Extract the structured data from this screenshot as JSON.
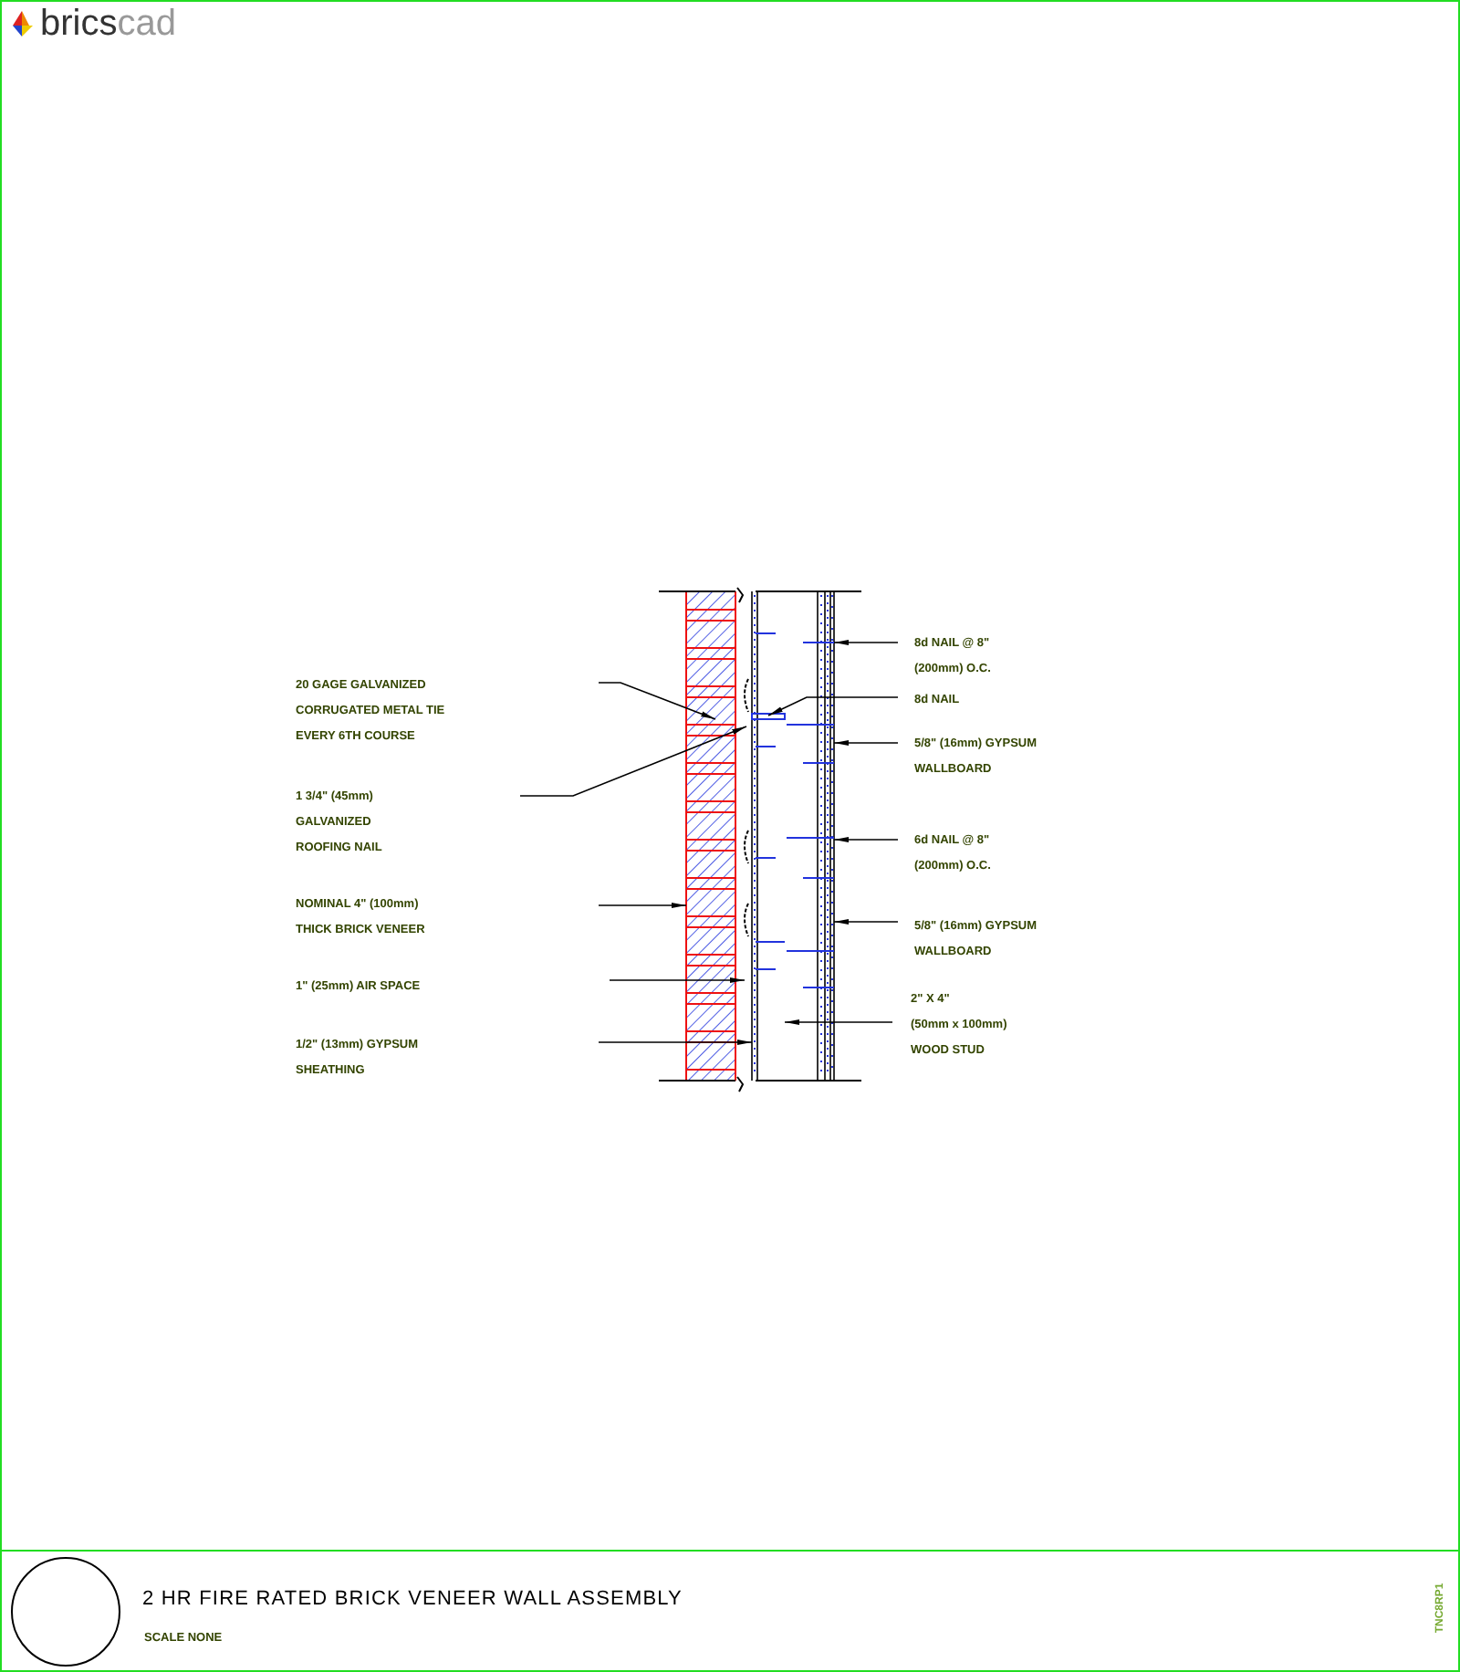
{
  "logo": {
    "brand": "brics",
    "product": "cad"
  },
  "notes_left": [
    {
      "lines": [
        "20 GAGE GALVANIZED",
        "CORRUGATED METAL TIE",
        "EVERY 6TH COURSE"
      ]
    },
    {
      "lines": [
        "1 3/4\" (45mm)",
        "GALVANIZED",
        "ROOFING NAIL"
      ]
    },
    {
      "lines": [
        "NOMINAL 4\" (100mm)",
        "THICK BRICK VENEER"
      ]
    },
    {
      "lines": [
        "1\" (25mm) AIR SPACE"
      ]
    },
    {
      "lines": [
        "1/2\" (13mm) GYPSUM",
        "SHEATHING"
      ]
    }
  ],
  "notes_right": [
    {
      "lines": [
        "8d NAIL @ 8\"",
        "(200mm) O.C."
      ]
    },
    {
      "lines": [
        "8d NAIL"
      ]
    },
    {
      "lines": [
        "5/8\" (16mm) GYPSUM",
        "WALLBOARD"
      ]
    },
    {
      "lines": [
        "6d NAIL @ 8\"",
        "(200mm) O.C."
      ]
    },
    {
      "lines": [
        "5/8\" (16mm) GYPSUM",
        "WALLBOARD"
      ]
    },
    {
      "lines": [
        "2\" X 4\"",
        "(50mm x 100mm)",
        "WOOD STUD"
      ]
    }
  ],
  "title_block": {
    "title": "2 HR FIRE RATED BRICK VENEER WALL ASSEMBLY",
    "scale": "SCALE NONE",
    "drawing_number": "TNC8RP1"
  }
}
